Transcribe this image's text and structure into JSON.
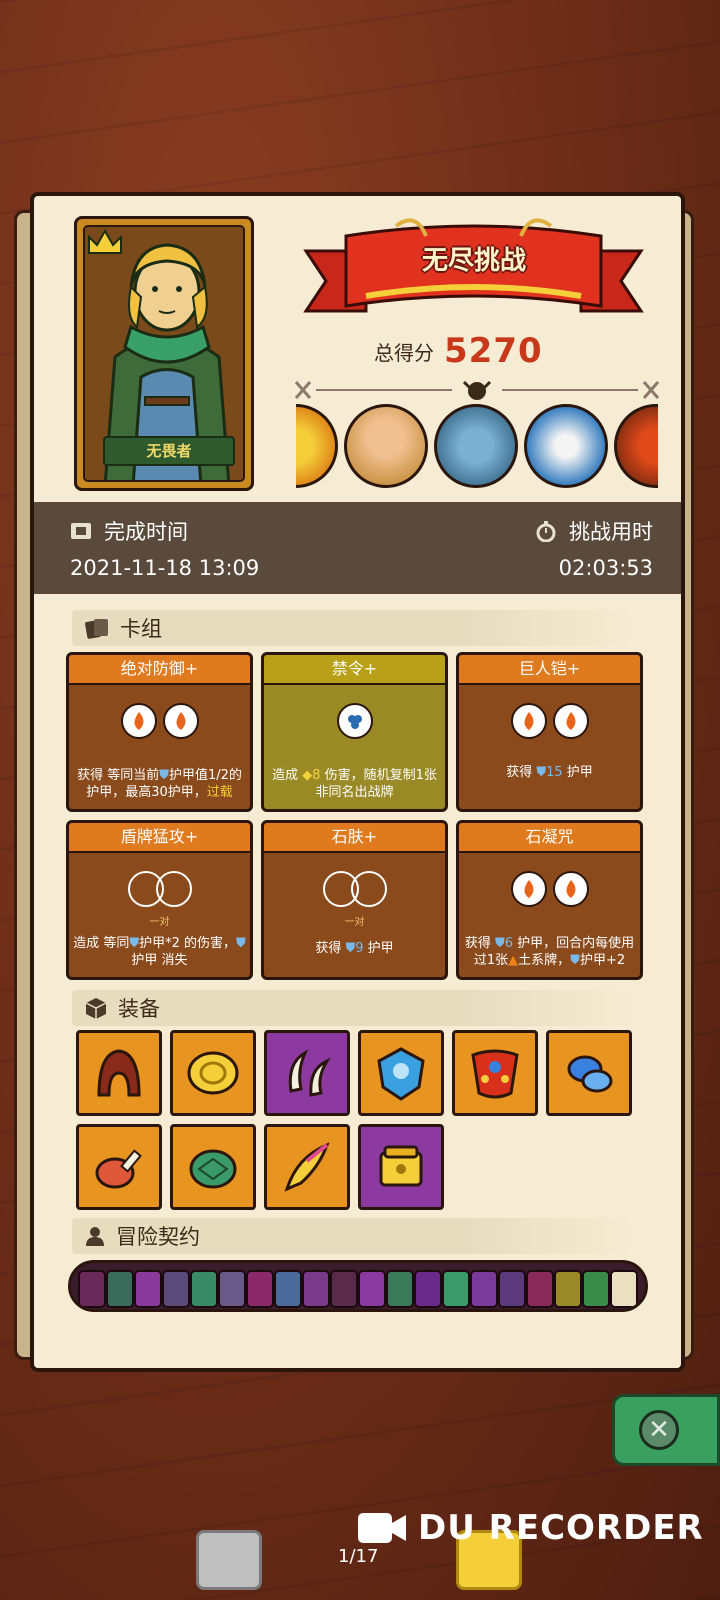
{
  "hero": {
    "name": "无畏者"
  },
  "banner": {
    "title": "无尽挑战"
  },
  "score": {
    "label": "总得分",
    "value": "5270"
  },
  "info": {
    "completion_label": "完成时间",
    "completion_value": "2021-11-18 13:09",
    "duration_label": "挑战用时",
    "duration_value": "02:03:53"
  },
  "sections": {
    "deck": "卡组",
    "equipment": "装备",
    "contracts": "冒险契约"
  },
  "cards": [
    {
      "title": "绝对防御+",
      "desc_a": "获得 等同当前",
      "desc_b": "护甲值1/2的护甲，最高30护甲，",
      "desc_hl": "过载",
      "style": "orange"
    },
    {
      "title": "禁令+",
      "desc_a": "造成 ",
      "desc_hl": "8",
      "desc_b": " 伤害，随机复制1张非同名出战牌",
      "style": "yellow"
    },
    {
      "title": "巨人铠+",
      "desc_a": "获得 ",
      "desc_hl": "15",
      "desc_b": " 护甲",
      "style": "orange"
    },
    {
      "title": "盾牌猛攻+",
      "pair": "一对",
      "desc_a": "造成 等同",
      "desc_b": "护甲*2 的伤害，",
      "desc_c": "护甲 消失",
      "style": "orange"
    },
    {
      "title": "石肤+",
      "pair": "一对",
      "desc_a": "获得 ",
      "desc_hl": "9",
      "desc_b": " 护甲",
      "style": "orange"
    },
    {
      "title": "石凝咒",
      "desc_a": "获得 ",
      "desc_hl": "6",
      "desc_b": " 护甲，回合内每使用过1张",
      "desc_c": "土系牌，",
      "desc_d": "护甲+2",
      "style": "orange"
    }
  ],
  "equipment": [
    {
      "icon": "hood-icon",
      "color": "orange"
    },
    {
      "icon": "gold-coin-icon",
      "color": "orange"
    },
    {
      "icon": "claws-icon",
      "color": "purple"
    },
    {
      "icon": "blue-gem-shield-icon",
      "color": "orange"
    },
    {
      "icon": "jeweled-armor-icon",
      "color": "orange"
    },
    {
      "icon": "blue-stones-icon",
      "color": "orange"
    },
    {
      "icon": "meat-icon",
      "color": "orange"
    },
    {
      "icon": "turtle-shell-icon",
      "color": "orange"
    },
    {
      "icon": "phoenix-feather-icon",
      "color": "orange"
    },
    {
      "icon": "golden-box-icon",
      "color": "purple"
    }
  ],
  "pagination": {
    "current": "1/17"
  },
  "watermark": {
    "text": "DU RECORDER"
  }
}
